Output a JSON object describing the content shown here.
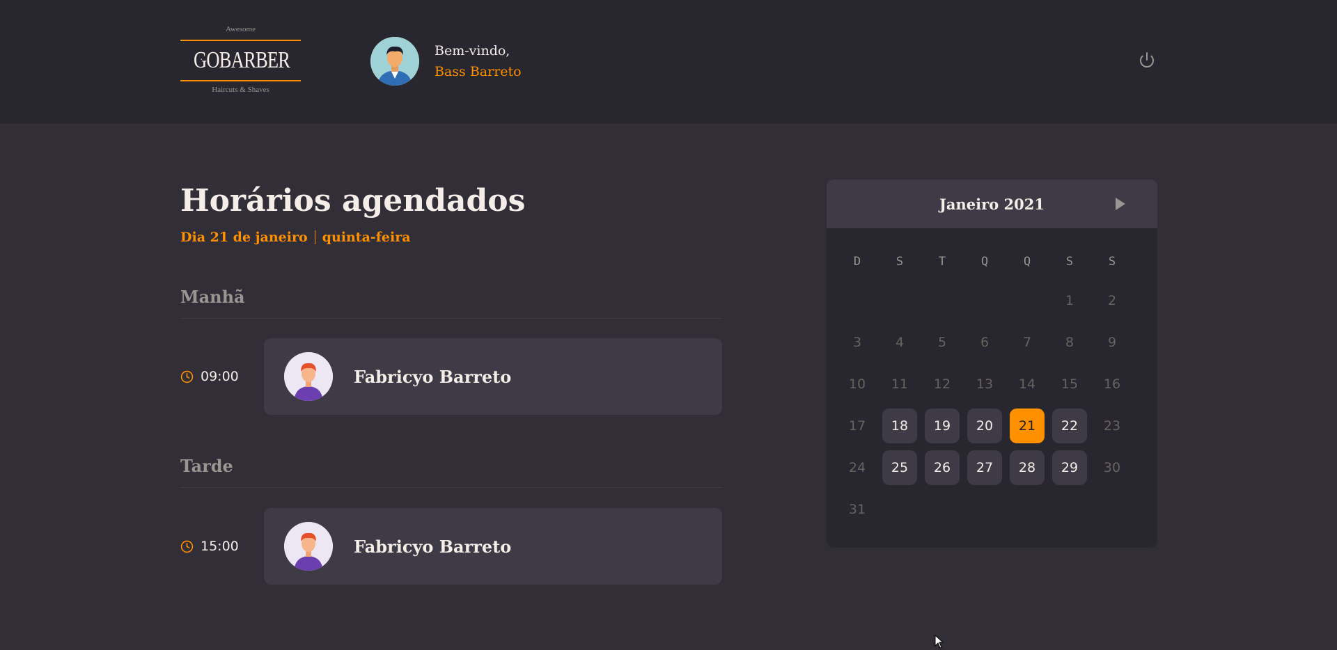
{
  "header": {
    "logo": {
      "top_text": "Awesome",
      "brand": "GOBARBER",
      "bottom_text": "Haircuts & Shaves"
    },
    "welcome": "Bem-vindo,",
    "user_name": "Bass Barreto",
    "power_icon": "power-icon"
  },
  "schedule": {
    "title": "Horários agendados",
    "date_label": "Dia 21 de janeiro",
    "weekday_label": "quinta-feira",
    "morning": {
      "title": "Manhã",
      "appointments": [
        {
          "time": "09:00",
          "name": "Fabricyo Barreto"
        }
      ]
    },
    "afternoon": {
      "title": "Tarde",
      "appointments": [
        {
          "time": "15:00",
          "name": "Fabricyo Barreto"
        }
      ]
    }
  },
  "calendar": {
    "month_label": "Janeiro 2021",
    "weekdays": [
      "D",
      "S",
      "T",
      "Q",
      "Q",
      "S",
      "S"
    ],
    "days": [
      "1",
      "2",
      "3",
      "4",
      "5",
      "6",
      "7",
      "8",
      "9",
      "10",
      "11",
      "12",
      "13",
      "14",
      "15",
      "16",
      "17",
      "18",
      "19",
      "20",
      "21",
      "22",
      "23",
      "24",
      "25",
      "26",
      "27",
      "28",
      "29",
      "30",
      "31"
    ],
    "available_days": [
      "18",
      "19",
      "20",
      "22",
      "25",
      "26",
      "27",
      "28",
      "29"
    ],
    "selected_day": "21",
    "first_weekday_index": 5
  },
  "colors": {
    "accent": "#ff9000",
    "background": "#312e38",
    "header": "#28262e",
    "card": "#3e3b47"
  }
}
